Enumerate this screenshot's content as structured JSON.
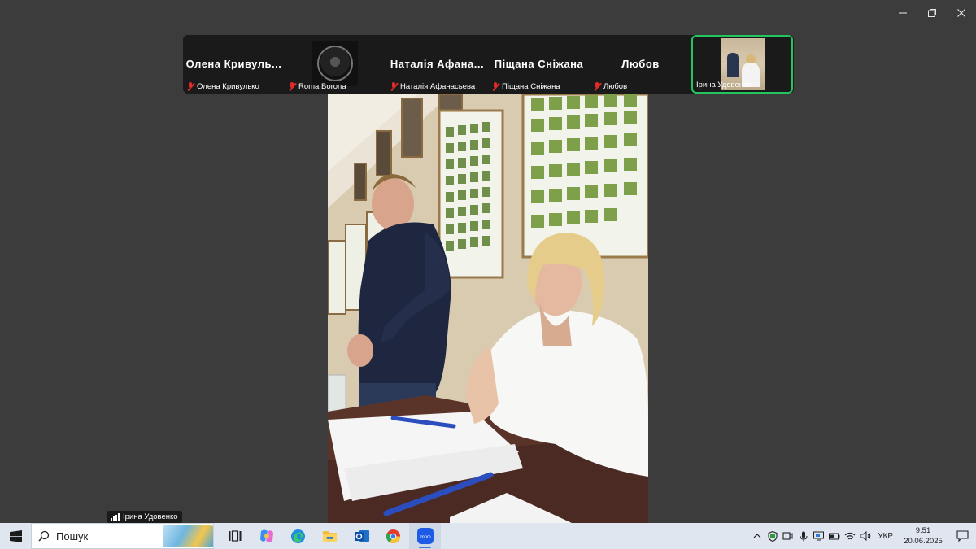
{
  "window": {
    "minimize_icon": "minimize-icon",
    "restore_icon": "restore-icon",
    "close_icon": "close-icon"
  },
  "participants": [
    {
      "display_name": "Олена  Кривуль...",
      "label": "Олена Кривулько",
      "muted": true
    },
    {
      "display_name": "",
      "label": "Roma Borona",
      "muted": true
    },
    {
      "display_name": "Наталія  Афана...",
      "label": "Наталія Афанасьева",
      "muted": true
    },
    {
      "display_name": "Піщана Сніжана",
      "label": "Піщана Сніжана",
      "muted": true
    },
    {
      "display_name": "Любов",
      "label": "Любов",
      "muted": true
    },
    {
      "display_name": "",
      "label": "Ірина Удовенко",
      "muted": false,
      "active": true
    }
  ],
  "main_video": {
    "speaker_label": "Ірина Удовенко"
  },
  "taskbar": {
    "search_placeholder": "Пошук",
    "apps": [
      "task-view-icon",
      "copilot-icon",
      "edge-icon",
      "file-explorer-icon",
      "outlook-icon",
      "chrome-icon",
      "zoom-icon"
    ],
    "tray": {
      "language": "УКР",
      "time": "9:51",
      "date": "20.06.2025"
    }
  },
  "colors": {
    "active_border": "#22c55e",
    "muted_mic": "#e02a2a",
    "background": "#3c3c3c",
    "taskbar": "#dfe6f0"
  }
}
